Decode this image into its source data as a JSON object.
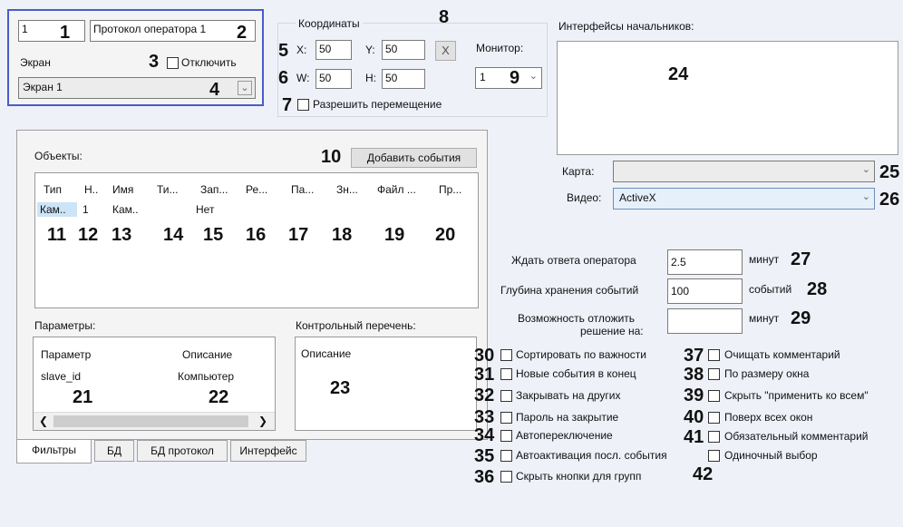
{
  "top_left": {
    "id_value": "1",
    "name_value": "Протокол оператора 1",
    "screen_label": "Экран",
    "disable_label": "Отключить",
    "screen_value": "Экран 1"
  },
  "coords": {
    "title": "Координаты",
    "x_label": "X:",
    "x_value": "50",
    "y_label": "Y:",
    "y_value": "50",
    "w_label": "W:",
    "w_value": "50",
    "h_label": "H:",
    "h_value": "50",
    "clear_label": "X",
    "monitor_label": "Монитор:",
    "monitor_value": "1",
    "allow_move_label": "Разрешить перемещение"
  },
  "objects": {
    "label": "Объекты:",
    "add_events_label": "Добавить события",
    "columns": [
      "Тип",
      "Н..",
      "Имя",
      "Ти...",
      "Зап...",
      "Ре...",
      "Па...",
      "Зн...",
      "Файл ...",
      "Пр..."
    ],
    "row": [
      "Кам..",
      "1",
      "Кам..",
      "",
      "Нет",
      "",
      "",
      "",
      "",
      ""
    ]
  },
  "params": {
    "label": "Параметры:",
    "col_param": "Параметр",
    "col_desc": "Описание",
    "row_param": "slave_id",
    "row_desc": "Компьютер"
  },
  "checklist": {
    "label": "Контрольный перечень:",
    "col_desc": "Описание"
  },
  "tabs": [
    "Фильтры",
    "БД",
    "БД протокол",
    "Интерфейс"
  ],
  "right": {
    "chiefs_label": "Интерфейсы начальников:",
    "map_label": "Карта:",
    "map_value": "",
    "video_label": "Видео:",
    "video_value": "ActiveX",
    "wait_label": "Ждать ответа оператора",
    "wait_value": "2.5",
    "wait_unit": "минут",
    "depth_label": "Глубина хранения событий",
    "depth_value": "100",
    "depth_unit": "событий",
    "postpone_label_1": "Возможность отложить",
    "postpone_label_2": "решение на:",
    "postpone_value": "",
    "postpone_unit": "минут"
  },
  "checkboxes_left": [
    "Сортировать по важности",
    "Новые события в конец",
    "Закрывать на других",
    "Пароль на закрытие",
    "Автопереключение",
    "Автоактивация посл. события",
    "Скрыть кнопки для групп"
  ],
  "checkboxes_right": [
    "Очищать комментарий",
    "По размеру окна",
    "Скрыть \"применить ко всем\"",
    "Поверх всех окон",
    "Обязательный комментарий",
    "Одиночный выбор"
  ],
  "callouts": {
    "n1": "1",
    "n2": "2",
    "n3": "3",
    "n4": "4",
    "n5": "5",
    "n6": "6",
    "n7": "7",
    "n8": "8",
    "n9": "9",
    "n10": "10",
    "n11": "11",
    "n12": "12",
    "n13": "13",
    "n14": "14",
    "n15": "15",
    "n16": "16",
    "n17": "17",
    "n18": "18",
    "n19": "19",
    "n20": "20",
    "n21": "21",
    "n22": "22",
    "n23": "23",
    "n24": "24",
    "n25": "25",
    "n26": "26",
    "n27": "27",
    "n28": "28",
    "n29": "29",
    "n30": "30",
    "n31": "31",
    "n32": "32",
    "n33": "33",
    "n34": "34",
    "n35": "35",
    "n36": "36",
    "n37": "37",
    "n38": "38",
    "n39": "39",
    "n40": "40",
    "n41": "41",
    "n42": "42"
  },
  "colors": {
    "background": "#eef1f8",
    "highlight_border": "#4a5cc9",
    "selected_row": "#cce4f7"
  }
}
